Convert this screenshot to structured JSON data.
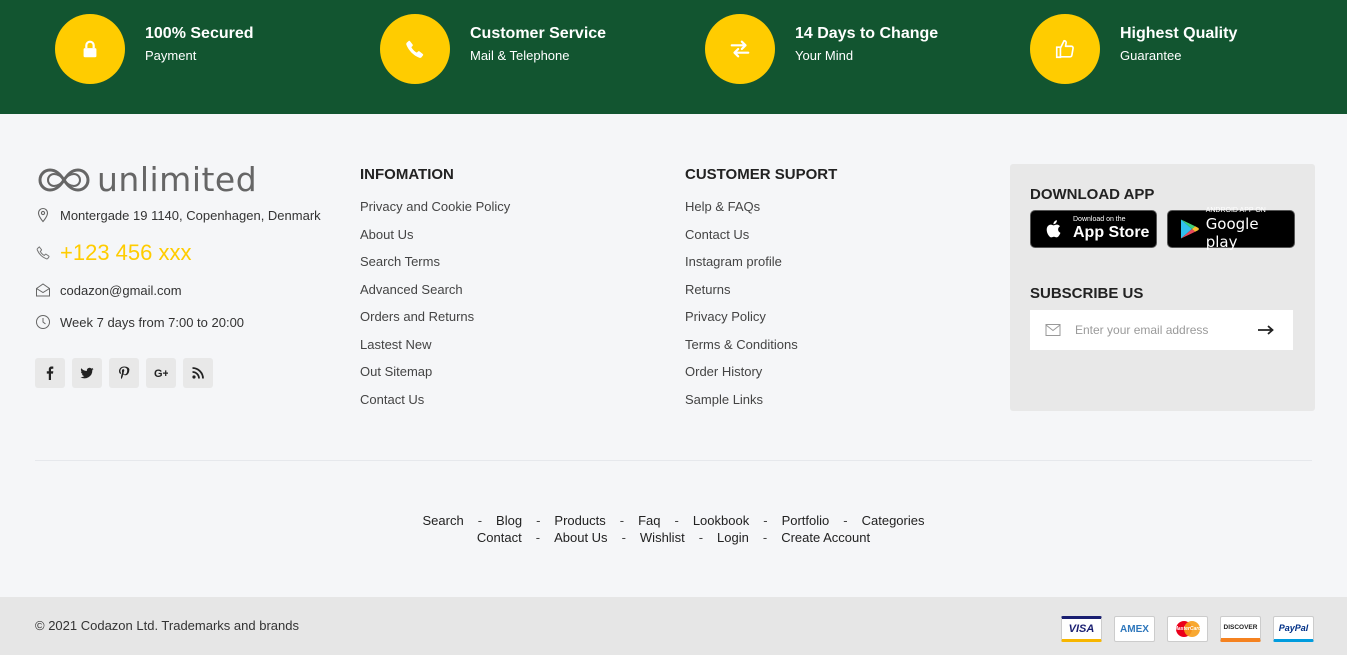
{
  "features": [
    {
      "title": "100% Secured",
      "subtitle": "Payment",
      "icon": "lock-icon"
    },
    {
      "title": "Customer Service",
      "subtitle": "Mail & Telephone",
      "icon": "phone-icon"
    },
    {
      "title": "14 Days to Change",
      "subtitle": "Your Mind",
      "icon": "exchange-icon"
    },
    {
      "title": "Highest Quality",
      "subtitle": "Guarantee",
      "icon": "thumbs-up-icon"
    }
  ],
  "colors": {
    "band": "#125530",
    "accent": "#ffcc00"
  },
  "brand": {
    "name": "unlimited"
  },
  "contact": {
    "address": "Montergade 19 1140, Copenhagen, Denmark",
    "phone": "+123 456 xxx",
    "email": "codazon@gmail.com",
    "hours": "Week 7 days from 7:00 to 20:00"
  },
  "socials": [
    "facebook-icon",
    "twitter-icon",
    "pinterest-icon",
    "google-plus-icon",
    "rss-icon"
  ],
  "information": {
    "heading": "INFOMATION",
    "links": [
      "Privacy and Cookie Policy",
      "About Us",
      "Search Terms",
      "Advanced Search",
      "Orders and Returns",
      "Lastest New",
      "Out Sitemap",
      "Contact Us"
    ]
  },
  "support": {
    "heading": "CUSTOMER SUPORT",
    "links": [
      "Help & FAQs",
      "Contact Us",
      "Instagram profile",
      "Returns",
      "Privacy Policy",
      "Terms & Conditions",
      "Order History",
      "Sample Links"
    ]
  },
  "app": {
    "heading": "DOWNLOAD APP",
    "appstore_small": "Download on the",
    "appstore_big": "App Store",
    "gplay_small": "ANDROID APP ON",
    "gplay_big": "Google play"
  },
  "subscribe": {
    "heading": "SUBSCRIBE US",
    "placeholder": "Enter your email address"
  },
  "bottom_links": {
    "row1": [
      "Search",
      "Blog",
      "Products",
      "Faq",
      "Lookbook",
      "Portfolio",
      "Categories"
    ],
    "row2": [
      "Contact",
      "About Us",
      "Wishlist",
      "Login",
      "Create Account"
    ],
    "separator": "-"
  },
  "copyright": "© 2021 Codazon Ltd. Trademarks and brands",
  "payments": [
    "VISA",
    "AMEX",
    "MasterCard",
    "DISCOVER",
    "PayPal"
  ]
}
